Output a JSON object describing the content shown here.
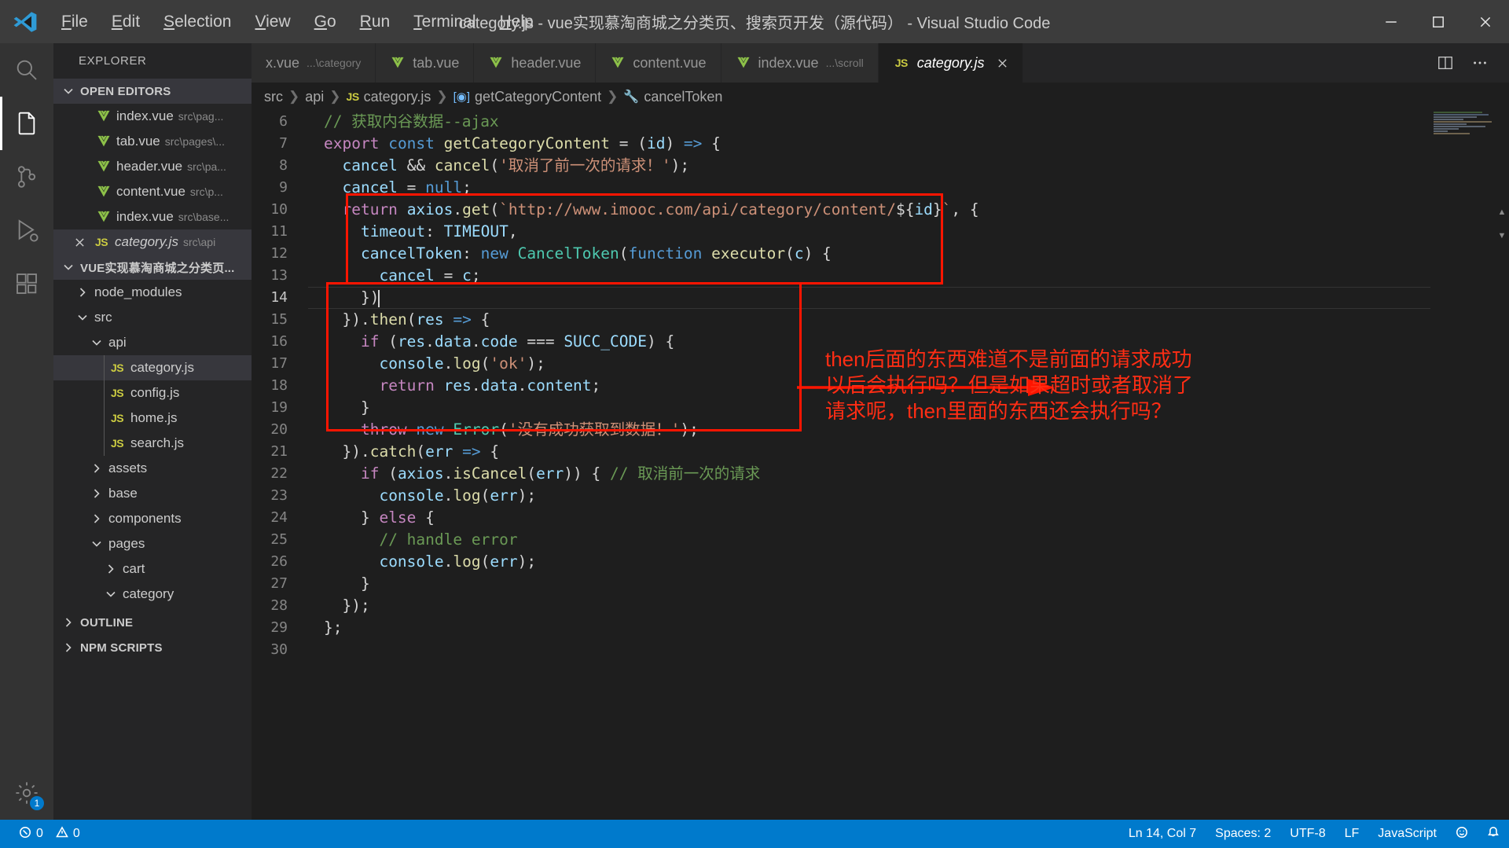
{
  "titlebar": {
    "menus": [
      {
        "label": "File",
        "accel": "F"
      },
      {
        "label": "Edit",
        "accel": "E"
      },
      {
        "label": "Selection",
        "accel": "S"
      },
      {
        "label": "View",
        "accel": "V"
      },
      {
        "label": "Go",
        "accel": "G"
      },
      {
        "label": "Run",
        "accel": "R"
      },
      {
        "label": "Terminal",
        "accel": "T"
      },
      {
        "label": "Help",
        "accel": "H"
      }
    ],
    "title": "category.js - vue实现慕淘商城之分类页、搜索页开发（源代码） - Visual Studio Code",
    "logo_icon": "vscode-logo-icon",
    "minimize_icon": "minimize-icon",
    "maximize_icon": "maximize-icon",
    "close_icon": "close-icon"
  },
  "activitybar": {
    "items": [
      {
        "name": "search-icon",
        "label": "Search"
      },
      {
        "name": "explorer-files-icon",
        "label": "Explorer",
        "active": true
      },
      {
        "name": "source-control-icon",
        "label": "Source Control"
      },
      {
        "name": "run-debug-icon",
        "label": "Run and Debug"
      },
      {
        "name": "extensions-icon",
        "label": "Extensions"
      },
      {
        "name": "settings-gear-icon",
        "label": "Manage",
        "badge": "1"
      }
    ]
  },
  "sidebar": {
    "title": "EXPLORER",
    "open_editors": {
      "label": "OPEN EDITORS",
      "items": [
        {
          "icon": "vue",
          "name": "index.vue",
          "path": "src\\pag...",
          "dirty": false,
          "active": false
        },
        {
          "icon": "vue",
          "name": "tab.vue",
          "path": "src\\pages\\...",
          "dirty": false,
          "active": false
        },
        {
          "icon": "vue",
          "name": "header.vue",
          "path": "src\\pa...",
          "dirty": false,
          "active": false
        },
        {
          "icon": "vue",
          "name": "content.vue",
          "path": "src\\p...",
          "dirty": false,
          "active": false
        },
        {
          "icon": "vue",
          "name": "index.vue",
          "path": "src\\base...",
          "dirty": false,
          "active": false
        },
        {
          "icon": "js",
          "name": "category.js",
          "path": "src\\api",
          "dirty": false,
          "active": true,
          "closable": true,
          "italic": true
        }
      ]
    },
    "project": {
      "label": "VUE实现慕淘商城之分类页...",
      "tree": [
        {
          "type": "folder",
          "name": "node_modules",
          "depth": 1,
          "expanded": false
        },
        {
          "type": "folder",
          "name": "src",
          "depth": 1,
          "expanded": true
        },
        {
          "type": "folder",
          "name": "api",
          "depth": 2,
          "expanded": true
        },
        {
          "type": "file",
          "name": "category.js",
          "depth": 3,
          "icon": "js",
          "selected": true
        },
        {
          "type": "file",
          "name": "config.js",
          "depth": 3,
          "icon": "js"
        },
        {
          "type": "file",
          "name": "home.js",
          "depth": 3,
          "icon": "js"
        },
        {
          "type": "file",
          "name": "search.js",
          "depth": 3,
          "icon": "js"
        },
        {
          "type": "folder",
          "name": "assets",
          "depth": 2,
          "expanded": false
        },
        {
          "type": "folder",
          "name": "base",
          "depth": 2,
          "expanded": false
        },
        {
          "type": "folder",
          "name": "components",
          "depth": 2,
          "expanded": false
        },
        {
          "type": "folder",
          "name": "pages",
          "depth": 2,
          "expanded": true
        },
        {
          "type": "folder",
          "name": "cart",
          "depth": 3,
          "expanded": false
        },
        {
          "type": "folder",
          "name": "category",
          "depth": 3,
          "expanded": true
        }
      ]
    },
    "outline_label": "OUTLINE",
    "npm_scripts_label": "NPM SCRIPTS"
  },
  "tabs": [
    {
      "icon": "vue",
      "label": "x.vue",
      "dim": "...\\category",
      "active": false,
      "partial": true
    },
    {
      "icon": "vue",
      "label": "tab.vue",
      "dim": "",
      "active": false
    },
    {
      "icon": "vue",
      "label": "header.vue",
      "dim": "",
      "active": false
    },
    {
      "icon": "vue",
      "label": "content.vue",
      "dim": "",
      "active": false
    },
    {
      "icon": "vue",
      "label": "index.vue",
      "dim": "...\\scroll",
      "active": false
    },
    {
      "icon": "js",
      "label": "category.js",
      "dim": "",
      "active": true,
      "italic": true,
      "closable": true
    }
  ],
  "tab_actions": [
    {
      "name": "split-editor-icon"
    },
    {
      "name": "more-actions-icon"
    }
  ],
  "breadcrumb": [
    {
      "label": "src",
      "icon": ""
    },
    {
      "label": "api",
      "icon": ""
    },
    {
      "label": "category.js",
      "icon": "js"
    },
    {
      "label": "getCategoryContent",
      "icon": "symbol-method"
    },
    {
      "label": "cancelToken",
      "icon": "wrench"
    }
  ],
  "editor": {
    "first_line": 6,
    "cursor_line": 14,
    "lines": [
      {
        "n": 6,
        "tokens": [
          {
            "t": "// ",
            "c": "c"
          },
          {
            "t": "获取内谷数据--ajax",
            "c": "c"
          }
        ]
      },
      {
        "n": 7,
        "tokens": [
          {
            "t": "export",
            "c": "k"
          },
          {
            "t": " ",
            "c": "p"
          },
          {
            "t": "const",
            "c": "kb"
          },
          {
            "t": " ",
            "c": "p"
          },
          {
            "t": "getCategoryContent",
            "c": "fn"
          },
          {
            "t": " = (",
            "c": "p"
          },
          {
            "t": "id",
            "c": "v"
          },
          {
            "t": ") ",
            "c": "p"
          },
          {
            "t": "=>",
            "c": "kb"
          },
          {
            "t": " {",
            "c": "p"
          }
        ]
      },
      {
        "n": 8,
        "indent": 1,
        "tokens": [
          {
            "t": "cancel",
            "c": "v"
          },
          {
            "t": " ",
            "c": "p"
          },
          {
            "t": "&&",
            "c": "p"
          },
          {
            "t": " ",
            "c": "p"
          },
          {
            "t": "cancel",
            "c": "fn"
          },
          {
            "t": "(",
            "c": "p"
          },
          {
            "t": "'取消了前一次的请求！'",
            "c": "s"
          },
          {
            "t": ");",
            "c": "p"
          }
        ]
      },
      {
        "n": 9,
        "indent": 1,
        "tokens": [
          {
            "t": "cancel",
            "c": "v"
          },
          {
            "t": " = ",
            "c": "p"
          },
          {
            "t": "null",
            "c": "kb"
          },
          {
            "t": ";",
            "c": "p"
          }
        ]
      },
      {
        "n": 10,
        "indent": 1,
        "tokens": [
          {
            "t": "return",
            "c": "k"
          },
          {
            "t": " ",
            "c": "p"
          },
          {
            "t": "axios",
            "c": "v"
          },
          {
            "t": ".",
            "c": "p"
          },
          {
            "t": "get",
            "c": "fn"
          },
          {
            "t": "(",
            "c": "p"
          },
          {
            "t": "`http://www.imooc.com/api/category/content/",
            "c": "s"
          },
          {
            "t": "${",
            "c": "p"
          },
          {
            "t": "id",
            "c": "v"
          },
          {
            "t": "}",
            "c": "p"
          },
          {
            "t": "`",
            "c": "s"
          },
          {
            "t": ", {",
            "c": "p"
          }
        ]
      },
      {
        "n": 11,
        "indent": 2,
        "tokens": [
          {
            "t": "timeout",
            "c": "v"
          },
          {
            "t": ": ",
            "c": "p"
          },
          {
            "t": "TIMEOUT",
            "c": "v"
          },
          {
            "t": ",",
            "c": "p"
          }
        ]
      },
      {
        "n": 12,
        "indent": 2,
        "tokens": [
          {
            "t": "cancelToken",
            "c": "v"
          },
          {
            "t": ": ",
            "c": "p"
          },
          {
            "t": "new",
            "c": "kb"
          },
          {
            "t": " ",
            "c": "p"
          },
          {
            "t": "CancelToken",
            "c": "t"
          },
          {
            "t": "(",
            "c": "p"
          },
          {
            "t": "function",
            "c": "kb"
          },
          {
            "t": " ",
            "c": "p"
          },
          {
            "t": "executor",
            "c": "fn"
          },
          {
            "t": "(",
            "c": "p"
          },
          {
            "t": "c",
            "c": "v"
          },
          {
            "t": ") {",
            "c": "p"
          }
        ]
      },
      {
        "n": 13,
        "indent": 3,
        "tokens": [
          {
            "t": "cancel",
            "c": "v"
          },
          {
            "t": " = ",
            "c": "p"
          },
          {
            "t": "c",
            "c": "v"
          },
          {
            "t": ";",
            "c": "p"
          }
        ]
      },
      {
        "n": 14,
        "indent": 2,
        "tokens": [
          {
            "t": "})",
            "c": "p"
          }
        ],
        "cursor": true
      },
      {
        "n": 15,
        "indent": 1,
        "tokens": [
          {
            "t": "}).",
            "c": "p"
          },
          {
            "t": "then",
            "c": "fn"
          },
          {
            "t": "(",
            "c": "p"
          },
          {
            "t": "res",
            "c": "v"
          },
          {
            "t": " ",
            "c": "p"
          },
          {
            "t": "=>",
            "c": "kb"
          },
          {
            "t": " {",
            "c": "p"
          }
        ]
      },
      {
        "n": 16,
        "indent": 2,
        "tokens": [
          {
            "t": "if",
            "c": "k"
          },
          {
            "t": " (",
            "c": "p"
          },
          {
            "t": "res",
            "c": "v"
          },
          {
            "t": ".",
            "c": "p"
          },
          {
            "t": "data",
            "c": "v"
          },
          {
            "t": ".",
            "c": "p"
          },
          {
            "t": "code",
            "c": "v"
          },
          {
            "t": " === ",
            "c": "p"
          },
          {
            "t": "SUCC_CODE",
            "c": "v"
          },
          {
            "t": ") {",
            "c": "p"
          }
        ]
      },
      {
        "n": 17,
        "indent": 3,
        "tokens": [
          {
            "t": "console",
            "c": "v"
          },
          {
            "t": ".",
            "c": "p"
          },
          {
            "t": "log",
            "c": "fn"
          },
          {
            "t": "(",
            "c": "p"
          },
          {
            "t": "'ok'",
            "c": "s"
          },
          {
            "t": ");",
            "c": "p"
          }
        ]
      },
      {
        "n": 18,
        "indent": 3,
        "tokens": [
          {
            "t": "return",
            "c": "k"
          },
          {
            "t": " ",
            "c": "p"
          },
          {
            "t": "res",
            "c": "v"
          },
          {
            "t": ".",
            "c": "p"
          },
          {
            "t": "data",
            "c": "v"
          },
          {
            "t": ".",
            "c": "p"
          },
          {
            "t": "content",
            "c": "v"
          },
          {
            "t": ";",
            "c": "p"
          }
        ]
      },
      {
        "n": 19,
        "indent": 2,
        "tokens": [
          {
            "t": "}",
            "c": "p"
          }
        ]
      },
      {
        "n": 20,
        "indent": 2,
        "tokens": [
          {
            "t": "throw",
            "c": "k"
          },
          {
            "t": " ",
            "c": "p"
          },
          {
            "t": "new",
            "c": "kb"
          },
          {
            "t": " ",
            "c": "p"
          },
          {
            "t": "Error",
            "c": "t"
          },
          {
            "t": "(",
            "c": "p"
          },
          {
            "t": "'没有成功获取到数据！'",
            "c": "s"
          },
          {
            "t": ");",
            "c": "p"
          }
        ]
      },
      {
        "n": 21,
        "indent": 1,
        "tokens": [
          {
            "t": "}).",
            "c": "p"
          },
          {
            "t": "catch",
            "c": "fn"
          },
          {
            "t": "(",
            "c": "p"
          },
          {
            "t": "err",
            "c": "v"
          },
          {
            "t": " ",
            "c": "p"
          },
          {
            "t": "=>",
            "c": "kb"
          },
          {
            "t": " {",
            "c": "p"
          }
        ]
      },
      {
        "n": 22,
        "indent": 2,
        "tokens": [
          {
            "t": "if",
            "c": "k"
          },
          {
            "t": " (",
            "c": "p"
          },
          {
            "t": "axios",
            "c": "v"
          },
          {
            "t": ".",
            "c": "p"
          },
          {
            "t": "isCancel",
            "c": "fn"
          },
          {
            "t": "(",
            "c": "p"
          },
          {
            "t": "err",
            "c": "v"
          },
          {
            "t": ")) { ",
            "c": "p"
          },
          {
            "t": "// 取消前一次的请求",
            "c": "c"
          }
        ]
      },
      {
        "n": 23,
        "indent": 3,
        "tokens": [
          {
            "t": "console",
            "c": "v"
          },
          {
            "t": ".",
            "c": "p"
          },
          {
            "t": "log",
            "c": "fn"
          },
          {
            "t": "(",
            "c": "p"
          },
          {
            "t": "err",
            "c": "v"
          },
          {
            "t": ");",
            "c": "p"
          }
        ]
      },
      {
        "n": 24,
        "indent": 2,
        "tokens": [
          {
            "t": "} ",
            "c": "p"
          },
          {
            "t": "else",
            "c": "k"
          },
          {
            "t": " {",
            "c": "p"
          }
        ]
      },
      {
        "n": 25,
        "indent": 3,
        "tokens": [
          {
            "t": "// handle error",
            "c": "c"
          }
        ]
      },
      {
        "n": 26,
        "indent": 3,
        "tokens": [
          {
            "t": "console",
            "c": "v"
          },
          {
            "t": ".",
            "c": "p"
          },
          {
            "t": "log",
            "c": "fn"
          },
          {
            "t": "(",
            "c": "p"
          },
          {
            "t": "err",
            "c": "v"
          },
          {
            "t": ");",
            "c": "p"
          }
        ]
      },
      {
        "n": 27,
        "indent": 2,
        "tokens": [
          {
            "t": "}",
            "c": "p"
          }
        ]
      },
      {
        "n": 28,
        "indent": 1,
        "tokens": [
          {
            "t": "});",
            "c": "p"
          }
        ]
      },
      {
        "n": 29,
        "tokens": [
          {
            "t": "};",
            "c": "p"
          }
        ]
      },
      {
        "n": 30,
        "tokens": []
      }
    ]
  },
  "annotations": {
    "box_color": "#ff1500",
    "text_color": "#ff2d14",
    "note": "then后面的东西难道不是前面的请求成功\n以后会执行吗？但是如果超时或者取消了\n请求呢，then里面的东西还会执行吗？"
  },
  "statusbar": {
    "errors_icon": "error-circle-icon",
    "errors": "0",
    "warnings_icon": "warning-triangle-icon",
    "warnings": "0",
    "cursor_position": "Ln 14, Col 7",
    "indentation": "Spaces: 2",
    "encoding": "UTF-8",
    "eol": "LF",
    "language": "JavaScript",
    "feedback_icon": "feedback-smiley-icon",
    "notifications_icon": "bell-icon",
    "accent_color": "#007acc"
  }
}
